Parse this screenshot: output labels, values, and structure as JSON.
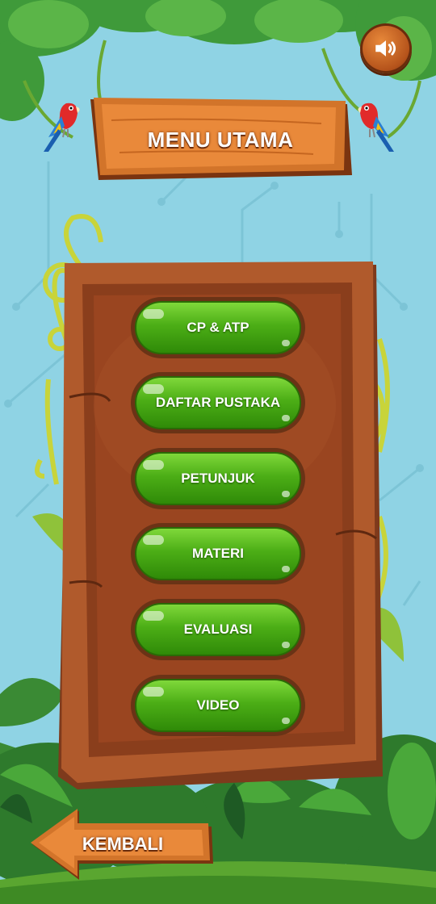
{
  "header": {
    "title": "MENU UTAMA",
    "sound_icon": "speaker-volume-icon"
  },
  "menu": {
    "items": [
      {
        "label": "CP & ATP"
      },
      {
        "label": "DAFTAR PUSTAKA"
      },
      {
        "label": "PETUNJUK"
      },
      {
        "label": "MATERI"
      },
      {
        "label": "EVALUASI"
      },
      {
        "label": "VIDEO"
      }
    ]
  },
  "footer": {
    "back_label": "KEMBALI",
    "back_icon": "arrow-left-icon"
  },
  "colors": {
    "sky": "#8fd3e4",
    "wood": "#b05a2c",
    "button_green": "#4cae16",
    "text": "#ffffff"
  }
}
